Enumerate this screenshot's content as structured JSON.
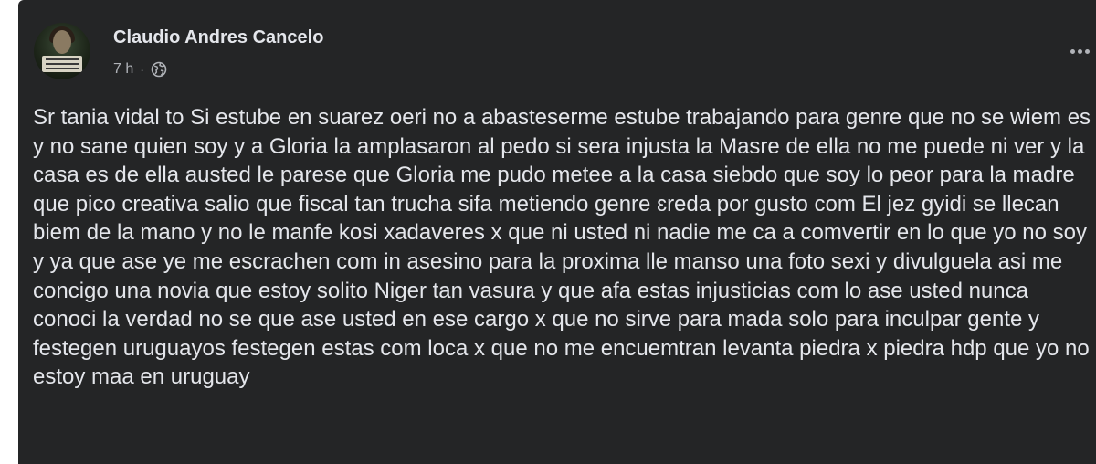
{
  "post": {
    "author_name": "Claudio Andres Cancelo",
    "timestamp": "7 h",
    "meta_separator": "·",
    "audience_icon": "globe-icon",
    "more_icon": "more-horizontal-icon",
    "body_text": "Sr tania vidal to Si estube en suarez oeri no a abasteserme estube trabajando para genre que no se wiem es y no sane quien soy y a Gloria la amplasaron al pedo si sera injusta la Masre de ella no me puede ni ver y la casa es de ella austed le parese que Gloria me pudo metee a la casa siebdo que soy lo peor para la madre que pico creativa salio que fiscal tan trucha sifa metiendo genre ɛreda por gusto com El jez gyidi se llecan biem de la mano y no le manfe kosi xadaveres x que ni usted ni nadie me ca a comvertir en lo que yo no soy y ya que ase ye me escrachen com in asesino para la proxima lle manso una foto sexi y divulguela asi me concigo una novia que estoy solito Niger tan vasura y que afa estas injusticias com lo ase usted nunca conoci la verdad no se que ase usted en ese cargo x que no sirve para mada solo para inculpar gente y festegen uruguayos festegen estas com loca x que no me encuemtran levanta piedra x piedra hdp que yo no estoy maa en uruguay"
  },
  "colors": {
    "card_background": "#242526",
    "primary_text": "#e4e6eb",
    "secondary_text": "#b0b3b8"
  }
}
